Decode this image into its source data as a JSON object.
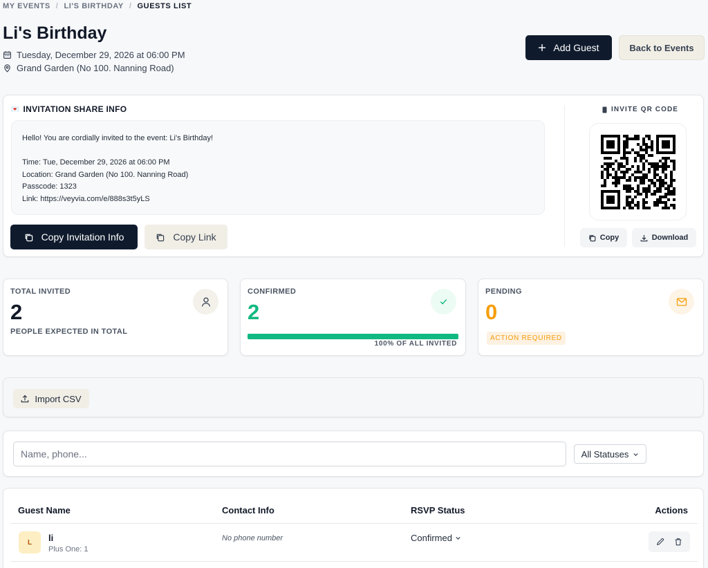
{
  "breadcrumb": {
    "item1": "MY EVENTS",
    "sep": "/",
    "item2": "LI'S BIRTHDAY",
    "item3": "GUESTS LIST"
  },
  "event": {
    "title": "Li's Birthday",
    "datetime": "Tuesday, December 29, 2026 at 06:00 PM",
    "location": "Grand Garden (No 100. Nanning Road)"
  },
  "header_actions": {
    "add_guest": "Add Guest",
    "back": "Back to Events"
  },
  "share": {
    "heading": "INVITATION SHARE INFO",
    "message": {
      "line1": "Hello! You are cordially invited to the event: Li's Birthday!",
      "line_time": "Time: Tue, December 29, 2026 at 06:00 PM",
      "line_location": "Location: Grand Garden (No 100. Nanning Road)",
      "line_passcode": "Passcode: 1323",
      "line_link": "Link: https://veyvia.com/e/888s3t5yLS"
    },
    "copy_info_label": "Copy Invitation Info",
    "copy_link_label": "Copy Link",
    "qr_heading": "INVITE QR CODE",
    "qr_copy_label": "Copy",
    "qr_download_label": "Download"
  },
  "stats": {
    "total": {
      "label": "TOTAL INVITED",
      "value": "2",
      "sub": "PEOPLE EXPECTED IN TOTAL"
    },
    "confirmed": {
      "label": "CONFIRMED",
      "value": "2",
      "progress": 1.0,
      "progress_text": "100% OF ALL INVITED",
      "color": "#10b981"
    },
    "pending": {
      "label": "PENDING",
      "value": "0",
      "badge": "ACTION REQUIRED",
      "color": "#f59e0b"
    }
  },
  "import": {
    "label": "Import CSV"
  },
  "filters": {
    "search_placeholder": "Name, phone...",
    "status_selected": "All Statuses"
  },
  "table": {
    "headers": {
      "name": "Guest Name",
      "contact": "Contact Info",
      "rsvp": "RSVP Status",
      "actions": "Actions"
    },
    "rows": [
      {
        "initial": "L",
        "name": "li",
        "plus_one": "Plus One: 1",
        "contact": "No phone number",
        "rsvp": "Confirmed"
      }
    ]
  },
  "colors": {
    "primary_dark": "#0f1b2d",
    "secondary_bg": "#f1eee6",
    "success": "#10b981",
    "warning": "#f59e0b"
  }
}
